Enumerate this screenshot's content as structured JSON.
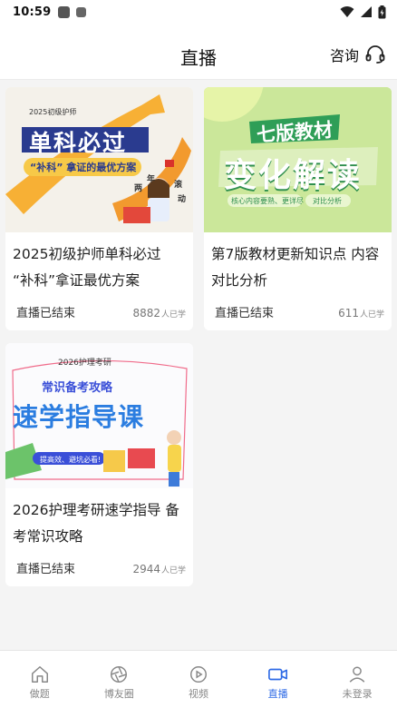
{
  "status_bar": {
    "time": "10:59"
  },
  "header": {
    "title": "直播",
    "consult_label": "咨询"
  },
  "courses": [
    {
      "thumb_line1": "2025初级护师",
      "thumb_line2": "单科必过",
      "thumb_line3": "“补科” 拿证的最优方案",
      "thumb_side1": "两",
      "thumb_side2": "年",
      "thumb_side3": "滚",
      "thumb_side4": "动",
      "title": "2025初级护师单科必过 “补科”拿证最优方案",
      "status": "直播已结束",
      "count": "8882",
      "count_unit": "人已学"
    },
    {
      "thumb_line1": "七版教材",
      "thumb_line2": "变化解读",
      "thumb_tag1": "核心内容要熟、更详尽",
      "thumb_tag2": "对比分析",
      "title": "第7版教材更新知识点 内容对比分析",
      "status": "直播已结束",
      "count": "611",
      "count_unit": "人已学"
    },
    {
      "thumb_line1": "2026护理考研",
      "thumb_line2": "常识备考攻略",
      "thumb_line3": "速学指导课",
      "thumb_tag1": "提高效、避坑必看!",
      "title": "2026护理考研速学指导 备考常识攻略",
      "status": "直播已结束",
      "count": "2944",
      "count_unit": "人已学"
    }
  ],
  "tabbar": {
    "items": [
      {
        "label": "做题",
        "icon": "home-icon"
      },
      {
        "label": "博友圈",
        "icon": "aperture-icon"
      },
      {
        "label": "视频",
        "icon": "play-circle-icon"
      },
      {
        "label": "直播",
        "icon": "video-camera-icon"
      },
      {
        "label": "未登录",
        "icon": "user-icon"
      }
    ],
    "active": "直播"
  },
  "colors": {
    "accent": "#2f6be6",
    "thumb1_bg": "#f4f1ea",
    "thumb2_bg": "#c6e58e",
    "thumb3_bg": "#ffffff"
  }
}
